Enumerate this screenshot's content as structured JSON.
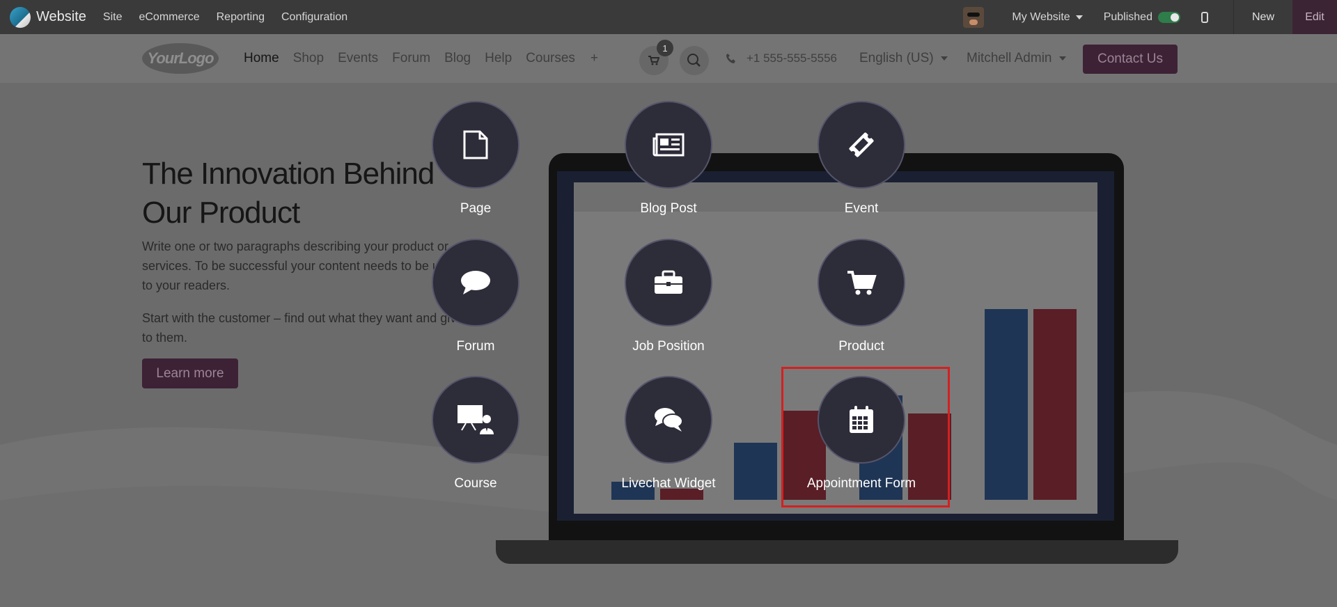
{
  "admin_bar": {
    "app_name": "Website",
    "menu": [
      "Site",
      "eCommerce",
      "Reporting",
      "Configuration"
    ],
    "website_selector": "My Website",
    "published_label": "Published",
    "published": true,
    "new_label": "New",
    "edit_label": "Edit"
  },
  "site_header": {
    "logo_text": "YourLogo",
    "nav": [
      "Home",
      "Shop",
      "Events",
      "Forum",
      "Blog",
      "Help",
      "Courses"
    ],
    "cart_count": "1",
    "phone": "+1 555-555-5556",
    "language": "English (US)",
    "user": "Mitchell Admin",
    "contact_label": "Contact Us"
  },
  "hero": {
    "title": "The Innovation Behind Our Product",
    "paragraph1": "Write one or two paragraphs describing your product or services. To be successful your content needs to be useful to your readers.",
    "paragraph2": "Start with the customer – find out what they want and give it to them.",
    "button": "Learn more"
  },
  "new_content": {
    "items": [
      {
        "label": "Page",
        "icon": "file-icon"
      },
      {
        "label": "Blog Post",
        "icon": "newspaper-icon"
      },
      {
        "label": "Event",
        "icon": "ticket-icon"
      },
      {
        "label": "Forum",
        "icon": "comment-icon"
      },
      {
        "label": "Job Position",
        "icon": "briefcase-icon"
      },
      {
        "label": "Product",
        "icon": "cart-icon"
      },
      {
        "label": "Course",
        "icon": "presentation-icon"
      },
      {
        "label": "Livechat Widget",
        "icon": "comments-icon"
      },
      {
        "label": "Appointment Form",
        "icon": "calendar-icon"
      }
    ],
    "highlighted": "Appointment Form"
  },
  "colors": {
    "admin_bar": "#3a3a3a",
    "edit_button": "#3b2434",
    "tile_bg": "#2d2c39",
    "highlight_border": "#d42020",
    "toggle_on": "#2e7d4a"
  }
}
